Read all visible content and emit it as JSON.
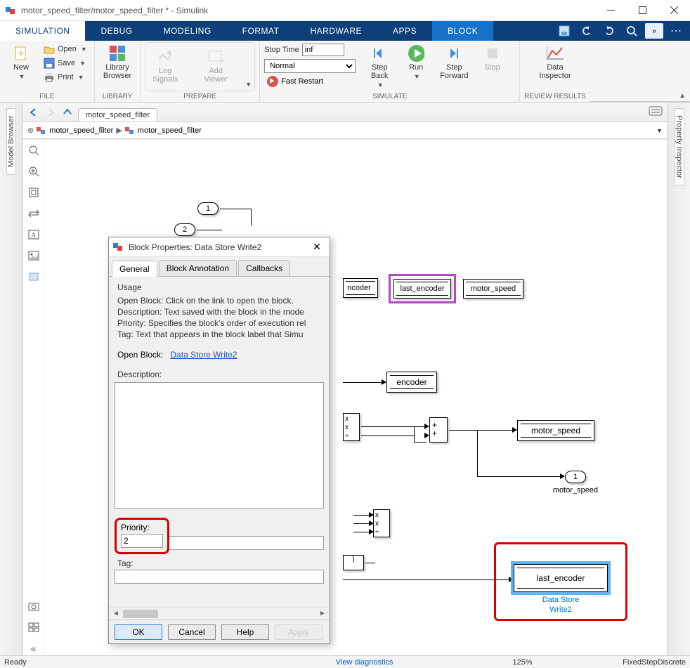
{
  "title": "motor_speed_filter/motor_speed_filter * - Simulink",
  "tabs": {
    "simulation": "SIMULATION",
    "debug": "DEBUG",
    "modeling": "MODELING",
    "format": "FORMAT",
    "hardware": "HARDWARE",
    "apps": "APPS",
    "block": "BLOCK"
  },
  "ribbon": {
    "file": {
      "new": "New",
      "open": "Open",
      "save": "Save",
      "print": "Print",
      "group": "FILE"
    },
    "library": {
      "btn": "Library\nBrowser",
      "group": "LIBRARY"
    },
    "prepare": {
      "log": "Log\nSignals",
      "add": "Add\nViewer",
      "group": "PREPARE"
    },
    "simulate": {
      "stoptime_label": "Stop Time",
      "stoptime_value": "inf",
      "mode": "Normal",
      "fast_restart": "Fast Restart",
      "step_back": "Step\nBack",
      "run": "Run",
      "step_fwd": "Step\nForward",
      "stop": "Stop",
      "group": "SIMULATE"
    },
    "review": {
      "inspector": "Data\nInspector",
      "group": "REVIEW RESULTS"
    }
  },
  "crumb_tab": "motor_speed_filter",
  "path": {
    "root": "motor_speed_filter",
    "child": "motor_speed_filter"
  },
  "side": {
    "left": "Model Browser",
    "right": "Property Inspector"
  },
  "blocks": {
    "inport1": "1",
    "inport2": "2",
    "dsm_encoder_partial": "ncoder",
    "dsm_last_encoder": "last_encoder",
    "dsm_motor_speed": "motor_speed",
    "dsw_encoder": "encoder",
    "dsw_motor_speed": "motor_speed",
    "dsw_last_encoder": "last_encoder",
    "outport1": "1",
    "outport_label": "motor_speed",
    "dsw2_caption_l1": "Data Store",
    "dsw2_caption_l2": "Write2",
    "prod_x": "x"
  },
  "dialog": {
    "title": "Block Properties: Data Store Write2",
    "tabs": {
      "general": "General",
      "annot": "Block Annotation",
      "cb": "Callbacks"
    },
    "usage_label": "Usage",
    "usage_lines": [
      "Open Block: Click on the link to open the block.",
      "Description: Text saved with the block in the mode",
      "Priority: Specifies the block's order of execution rel",
      "Tag: Text that appears in the block label that Simu"
    ],
    "openblock_label": "Open Block:",
    "openblock_link": "Data Store Write2",
    "description_label": "Description:",
    "priority_label": "Priority:",
    "priority_value": "2",
    "tag_label": "Tag:",
    "tag_value": "",
    "buttons": {
      "ok": "OK",
      "cancel": "Cancel",
      "help": "Help",
      "apply": "Apply"
    }
  },
  "status": {
    "ready": "Ready",
    "viewdiag": "View diagnostics",
    "zoom": "125%",
    "solver": "FixedStepDiscrete"
  }
}
